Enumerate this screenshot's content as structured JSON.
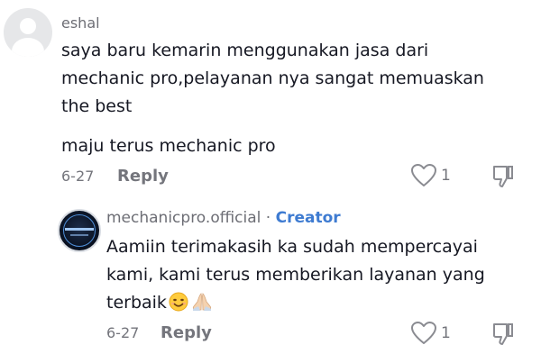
{
  "comment": {
    "username": "eshal",
    "text": "saya baru kemarin menggunakan jasa dari\nmechanic pro,pelayanan nya sangat memuaskan\nthe best",
    "text2": "maju terus mechanic pro",
    "date": "6-27",
    "reply_label": "Reply",
    "like_count": "1",
    "avatar_icon": "default-avatar-icon",
    "like_icon": "heart-outline-icon",
    "dislike_icon": "thumbs-down-icon"
  },
  "reply": {
    "username": "mechanicpro.official",
    "separator": "·",
    "badge": "Creator",
    "text": "Aamiin terimakasih ka sudah mempercayai kami, kami terus memberikan layanan yang terbaik",
    "emoji_1": "smiling-face-icon",
    "emoji_2": "folded-hands-icon",
    "date": "6-27",
    "reply_label": "Reply",
    "like_count": "1",
    "accent_color": "#3e7bd1"
  }
}
